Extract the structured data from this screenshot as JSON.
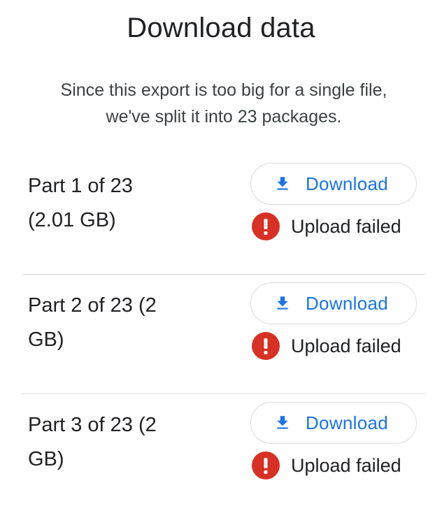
{
  "dialog": {
    "title": "Download data",
    "description_line1": "Since this export is too big for a single file,",
    "description_line2": "we've split it into 23 packages."
  },
  "packages": [
    {
      "label_line1": "Part 1 of 23",
      "label_line2": "(2.01 GB)",
      "download_label": "Download",
      "status": "Upload failed"
    },
    {
      "label_line1": "Part 2 of 23 (2",
      "label_line2": "GB)",
      "download_label": "Download",
      "status": "Upload failed"
    },
    {
      "label_line1": "Part 3 of 23 (2",
      "label_line2": "GB)",
      "download_label": "Download",
      "status": "Upload failed"
    }
  ],
  "icons": {
    "download": "download-icon",
    "error": "error-icon"
  },
  "colors": {
    "accent": "#1a73e8",
    "error": "#d93025",
    "divider": "#dadce0"
  }
}
